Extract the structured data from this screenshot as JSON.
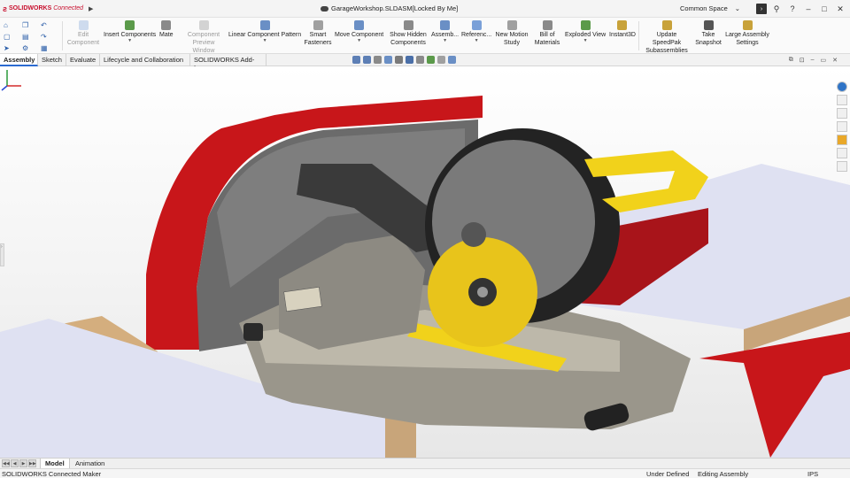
{
  "app": {
    "brand": "SOLIDWORKS",
    "brand_suffix": "Connected",
    "document_title": "GarageWorkshop.SLDASM[Locked By Me]",
    "workspace": "Common Space"
  },
  "ribbon": {
    "buttons": [
      {
        "id": "edit-component",
        "label": "Edit Component",
        "disabled": true,
        "icon": "edit-component-icon"
      },
      {
        "id": "insert-components",
        "label": "Insert Components",
        "disabled": false,
        "icon": "insert-components-icon"
      },
      {
        "id": "mate",
        "label": "Mate",
        "disabled": false,
        "icon": "mate-icon"
      },
      {
        "id": "component-preview-window",
        "label": "Component Preview Window",
        "disabled": true,
        "icon": "preview-window-icon"
      },
      {
        "id": "linear-component-pattern",
        "label": "Linear Component Pattern",
        "disabled": false,
        "icon": "pattern-icon"
      },
      {
        "id": "smart-fasteners",
        "label": "Smart Fasteners",
        "disabled": false,
        "icon": "fastener-icon"
      },
      {
        "id": "move-component",
        "label": "Move Component",
        "disabled": false,
        "icon": "move-icon"
      },
      {
        "id": "show-hidden-components",
        "label": "Show Hidden Components",
        "disabled": false,
        "icon": "show-hidden-icon"
      },
      {
        "id": "assembly-features",
        "label": "Assemb...",
        "disabled": false,
        "icon": "assembly-features-icon"
      },
      {
        "id": "reference-geometry",
        "label": "Referenc...",
        "disabled": false,
        "icon": "reference-geometry-icon"
      },
      {
        "id": "new-motion-study",
        "label": "New Motion Study",
        "disabled": false,
        "icon": "motion-study-icon"
      },
      {
        "id": "bill-of-materials",
        "label": "Bill of Materials",
        "disabled": false,
        "icon": "bom-icon"
      },
      {
        "id": "exploded-view",
        "label": "Exploded View",
        "disabled": false,
        "icon": "exploded-view-icon"
      },
      {
        "id": "instant3d",
        "label": "Instant3D",
        "disabled": false,
        "icon": "instant3d-icon"
      },
      {
        "id": "update-speedpak",
        "label": "Update SpeedPak Subassemblies",
        "disabled": false,
        "icon": "speedpak-icon"
      },
      {
        "id": "take-snapshot",
        "label": "Take Snapshot",
        "disabled": false,
        "icon": "camera-icon"
      },
      {
        "id": "large-assembly-settings",
        "label": "Large Assembly Settings",
        "disabled": false,
        "icon": "large-assembly-icon"
      }
    ]
  },
  "tabs": [
    "Assembly",
    "Sketch",
    "Evaluate",
    "Lifecycle and Collaboration",
    "SOLIDWORKS Add-Ins"
  ],
  "active_tab": "Assembly",
  "bottom_tabs": [
    "Model",
    "Animation"
  ],
  "active_bottom_tab": "Model",
  "status": {
    "left": "SOLIDWORKS Connected Maker",
    "definition": "Under Defined",
    "mode": "Editing Assembly",
    "units": "IPS"
  },
  "colors": {
    "accent": "#2b6ad1",
    "brand_red": "#c8102e",
    "part_red": "#c8161a",
    "saw_yellow": "#f1d21b",
    "surface_blue": "#dfe1f2",
    "wood": "#c8a57a"
  }
}
